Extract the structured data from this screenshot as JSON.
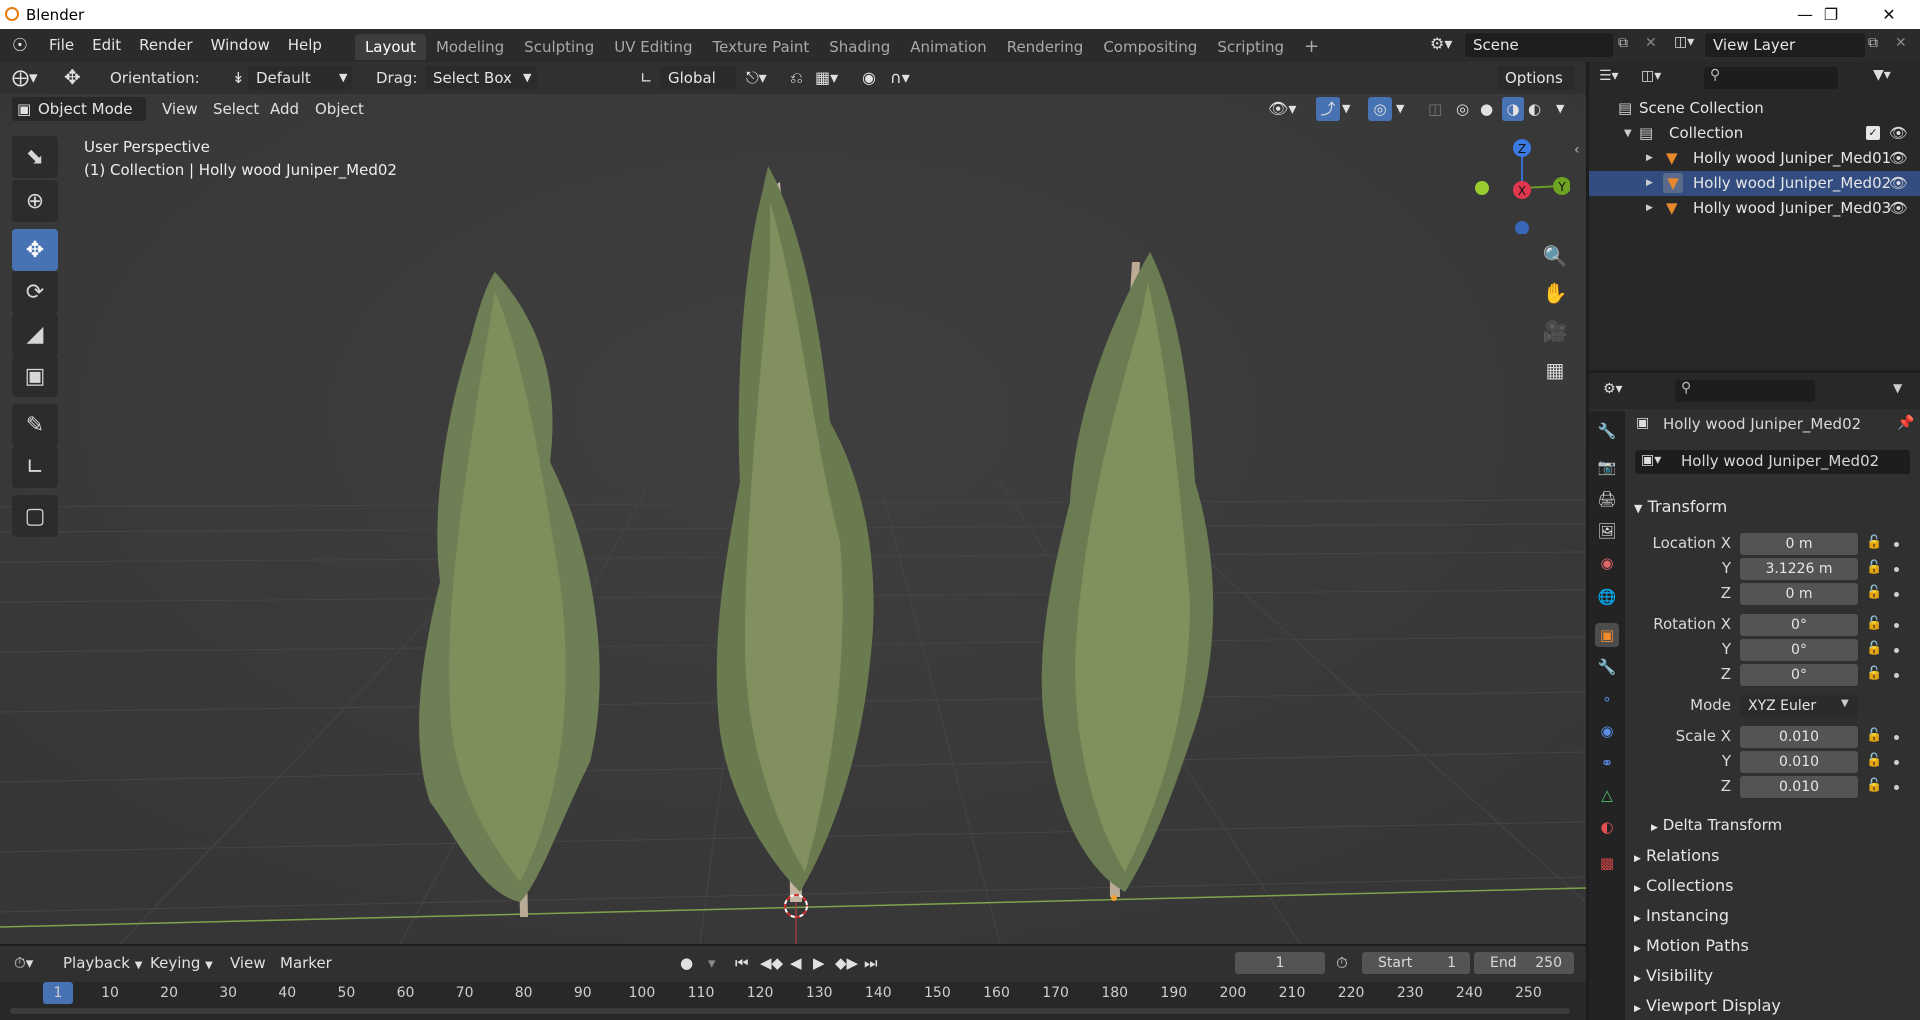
{
  "window": {
    "title": "Blender"
  },
  "menu": [
    "File",
    "Edit",
    "Render",
    "Window",
    "Help"
  ],
  "workspaces": [
    "Layout",
    "Modeling",
    "Sculpting",
    "UV Editing",
    "Texture Paint",
    "Shading",
    "Animation",
    "Rendering",
    "Compositing",
    "Scripting"
  ],
  "active_workspace": "Layout",
  "scene": "Scene",
  "view_layer": "View Layer",
  "tool_header": {
    "orientation_label": "Orientation:",
    "orientation_value": "Default",
    "drag_label": "Drag:",
    "drag_value": "Select Box",
    "transform_orientation": "Global",
    "options": "Options"
  },
  "viewport_header": {
    "mode": "Object Mode",
    "menus": [
      "View",
      "Select",
      "Add",
      "Object"
    ]
  },
  "viewport": {
    "perspective": "User Perspective",
    "context": "(1) Collection | Holly wood Juniper_Med02"
  },
  "gizmo": {
    "z": "Z",
    "x": "X",
    "y": "Y"
  },
  "outliner": {
    "root": "Scene Collection",
    "collection": "Collection",
    "objects": [
      "Holly wood Juniper_Med01",
      "Holly wood Juniper_Med02",
      "Holly wood Juniper_Med03"
    ]
  },
  "properties": {
    "object_name": "Holly wood Juniper_Med02",
    "object_field": "Holly wood Juniper_Med02",
    "transform_title": "Transform",
    "location_label": "Location X",
    "location": {
      "x": "0 m",
      "y": "3.1226 m",
      "z": "0 m"
    },
    "rotation_label": "Rotation X",
    "rotation": {
      "x": "0°",
      "y": "0°",
      "z": "0°"
    },
    "mode_label": "Mode",
    "mode_value": "XYZ Euler",
    "scale_label": "Scale X",
    "scale": {
      "x": "0.010",
      "y": "0.010",
      "z": "0.010"
    },
    "y_label": "Y",
    "z_label": "Z",
    "delta": "Delta Transform",
    "sections": [
      "Relations",
      "Collections",
      "Instancing",
      "Motion Paths",
      "Visibility",
      "Viewport Display"
    ]
  },
  "timeline": {
    "menus": [
      "Playback",
      "Keying",
      "View",
      "Marker"
    ],
    "current_frame": "1",
    "start_label": "Start",
    "start": "1",
    "end_label": "End",
    "end": "250",
    "ticks": [
      "1",
      "10",
      "20",
      "30",
      "40",
      "50",
      "60",
      "70",
      "80",
      "90",
      "100",
      "110",
      "120",
      "130",
      "140",
      "150",
      "160",
      "170",
      "180",
      "190",
      "200",
      "210",
      "220",
      "230",
      "240",
      "250"
    ]
  }
}
